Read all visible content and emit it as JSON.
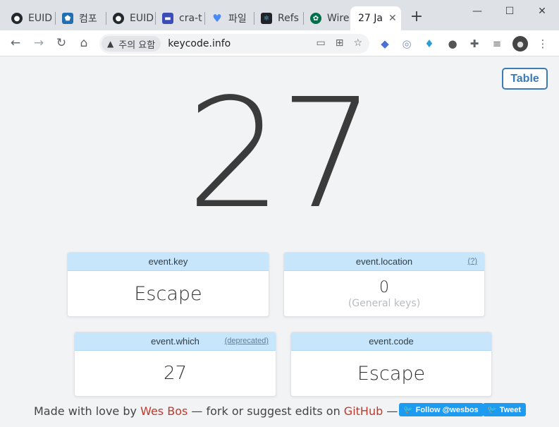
{
  "browser": {
    "tabs": [
      {
        "title": "EUID",
        "icon": "github-icon"
      },
      {
        "title": "컴포",
        "icon": "pentagon-icon"
      },
      {
        "title": "EUID",
        "icon": "github-icon"
      },
      {
        "title": "cra-t",
        "icon": "app-icon"
      },
      {
        "title": "파일",
        "icon": "heart-icon"
      },
      {
        "title": "Refs",
        "icon": "react-icon"
      },
      {
        "title": "Wire",
        "icon": "starbucks-icon"
      }
    ],
    "active_tab": {
      "title": "27  Ja",
      "close": "✕"
    },
    "new_tab": "+",
    "window_controls": {
      "minimize": "—",
      "maximize": "☐",
      "close": "✕"
    },
    "security_chip": "주의 요함",
    "url": "keycode.info"
  },
  "page": {
    "table_button": "Table",
    "key_code": "27",
    "cards": {
      "event_key": {
        "label": "event.key",
        "value": "Escape"
      },
      "event_location": {
        "label": "event.location",
        "aside": "(?)",
        "value": "0",
        "sub": "(General keys)"
      },
      "event_which": {
        "label": "event.which",
        "aside": "(deprecated)",
        "value": "27"
      },
      "event_code": {
        "label": "event.code",
        "value": "Escape"
      }
    },
    "footer": {
      "prefix": "Made with love by ",
      "author": "Wes Bos",
      "middle": " — fork or suggest edits on ",
      "repo": "GitHub",
      "suffix": " —"
    },
    "follow_button": "Follow @wesbos",
    "tweet_button": "Tweet"
  },
  "colors": {
    "accent": "#3a7bb8",
    "card_header": "#c7e6fb",
    "link": "#c0392b",
    "twitter": "#1d9bf0"
  }
}
